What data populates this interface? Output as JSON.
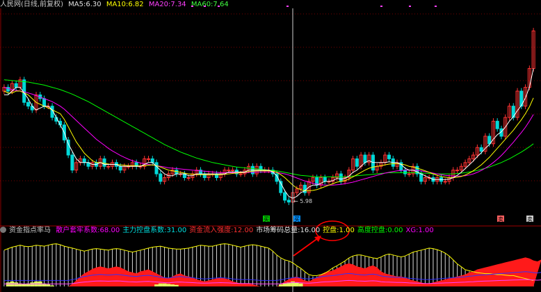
{
  "top_legend": {
    "stock": "人民网(日线,前复权)",
    "ma5_label": "MA5:",
    "ma5": "6.30",
    "ma10_label": "MA10:",
    "ma10": "6.82",
    "ma20_label": "MA20:",
    "ma20": "7.34",
    "ma60_label": "MA60:",
    "ma60": "7.64"
  },
  "indicator_legend": {
    "name": "资金指点率马",
    "items": [
      {
        "label": "散户套牢系数:",
        "value": "68.00",
        "color": "#ff00ff"
      },
      {
        "label": "主力控盘系数:",
        "value": "31.00",
        "color": "#00e0e0"
      },
      {
        "label": "资金流入强度:",
        "value": "12.00",
        "color": "#ff3030"
      },
      {
        "label": "市场筹码总量:",
        "value": "16.00",
        "color": "#e0e0e0"
      },
      {
        "label": "控盘:",
        "value": "1.00",
        "color": "#ffff00"
      },
      {
        "label": "高度控盘:",
        "value": "0.00",
        "color": "#00ff00"
      },
      {
        "label": "XG:",
        "value": "1.00",
        "color": "#ff00ff"
      }
    ]
  },
  "markers": {
    "low_label": "5.98",
    "buy_labels": [
      "买",
      "买"
    ],
    "sell_label": "卖"
  },
  "colors": {
    "up": "#ff3232",
    "down": "#00d8d8",
    "ma5": "#ffffff",
    "ma10": "#ffff00",
    "ma20": "#ff00ff",
    "ma60": "#00ff00",
    "grid": "#7a0000",
    "crosshair": "#d0d0d0",
    "annotation": "#ff0000"
  },
  "chart_data": {
    "type": "candlestick",
    "price_range": [
      5.6,
      11.2
    ],
    "grid": true,
    "closes": [
      9.1,
      9.0,
      9.2,
      9.1,
      9.3,
      8.7,
      8.6,
      8.5,
      8.9,
      8.8,
      8.6,
      8.6,
      8.3,
      8.2,
      8.1,
      7.7,
      7.3,
      6.9,
      7.1,
      7.2,
      7.1,
      7.0,
      7.1,
      7.0,
      7.2,
      7.0,
      7.0,
      7.1,
      7.0,
      6.9,
      7.0,
      7.0,
      7.1,
      7.0,
      7.0,
      7.2,
      7.2,
      7.1,
      6.8,
      6.6,
      6.7,
      6.8,
      6.9,
      6.8,
      6.8,
      6.7,
      6.7,
      6.8,
      6.9,
      6.8,
      6.7,
      6.8,
      6.8,
      6.7,
      6.8,
      6.9,
      6.9,
      6.9,
      6.8,
      6.8,
      6.9,
      7.0,
      6.8,
      7.0,
      6.9,
      6.9,
      6.9,
      6.8,
      6.6,
      6.3,
      6.1,
      6.05,
      6.3,
      6.4,
      6.5,
      6.3,
      6.6,
      6.7,
      6.5,
      6.7,
      6.6,
      6.6,
      6.7,
      6.8,
      6.6,
      6.7,
      6.9,
      7.2,
      7.0,
      7.3,
      7.1,
      7.3,
      6.9,
      7.0,
      7.1,
      7.3,
      7.2,
      7.0,
      7.1,
      6.9,
      6.8,
      6.8,
      7.0,
      6.8,
      6.6,
      6.7,
      6.7,
      6.6,
      6.7,
      6.6,
      6.6,
      6.7,
      6.9,
      6.9,
      7.0,
      7.1,
      7.2,
      7.3,
      7.5,
      7.4,
      7.8,
      7.6,
      8.2,
      8.0,
      7.8,
      8.3,
      8.6,
      8.3,
      9.0,
      8.6,
      9.1,
      9.6,
      10.6
    ],
    "ma5": [
      8.9,
      8.9,
      9.0,
      9.1,
      9.1,
      8.95,
      8.8,
      8.6,
      8.5,
      8.55,
      8.6,
      8.6,
      8.5,
      8.3,
      8.1,
      7.9,
      7.6,
      7.4,
      7.2,
      7.1,
      7.1,
      7.1,
      7.05,
      7.05,
      7.1,
      7.05,
      7.05,
      7.05,
      7.05,
      7.0,
      7.0,
      7.0,
      7.0,
      7.0,
      7.0,
      7.05,
      7.1,
      7.1,
      7.0,
      6.9,
      6.8,
      6.75,
      6.75,
      6.8,
      6.8,
      6.8,
      6.75,
      6.75,
      6.8,
      6.8,
      6.8,
      6.8,
      6.8,
      6.8,
      6.8,
      6.8,
      6.85,
      6.85,
      6.85,
      6.85,
      6.85,
      6.9,
      6.9,
      6.9,
      6.9,
      6.9,
      6.9,
      6.85,
      6.75,
      6.55,
      6.35,
      6.2,
      6.15,
      6.2,
      6.3,
      6.35,
      6.45,
      6.5,
      6.5,
      6.55,
      6.6,
      6.6,
      6.62,
      6.68,
      6.66,
      6.68,
      6.74,
      6.84,
      6.9,
      7.0,
      7.1,
      7.15,
      7.1,
      7.1,
      7.1,
      7.1,
      7.12,
      7.1,
      7.1,
      7.05,
      6.95,
      6.9,
      6.9,
      6.85,
      6.8,
      6.75,
      6.7,
      6.65,
      6.65,
      6.65,
      6.65,
      6.66,
      6.7,
      6.76,
      6.84,
      6.94,
      7.04,
      7.14,
      7.26,
      7.36,
      7.48,
      7.58,
      7.72,
      7.84,
      7.92,
      8.04,
      8.2,
      8.32,
      8.48,
      8.62,
      8.82,
      9.1,
      9.6
    ],
    "ma10": [
      9.0,
      8.95,
      8.95,
      9.0,
      9.0,
      8.95,
      8.9,
      8.8,
      8.7,
      8.65,
      8.6,
      8.55,
      8.5,
      8.45,
      8.4,
      8.25,
      8.05,
      7.85,
      7.65,
      7.5,
      7.35,
      7.25,
      7.15,
      7.1,
      7.1,
      7.08,
      7.06,
      7.05,
      7.05,
      7.04,
      7.03,
      7.02,
      7.02,
      7.02,
      7.01,
      7.02,
      7.03,
      7.04,
      7.02,
      6.98,
      6.94,
      6.9,
      6.88,
      6.86,
      6.84,
      6.82,
      6.8,
      6.79,
      6.78,
      6.78,
      6.78,
      6.78,
      6.78,
      6.78,
      6.78,
      6.79,
      6.8,
      6.81,
      6.82,
      6.83,
      6.84,
      6.86,
      6.87,
      6.88,
      6.88,
      6.88,
      6.88,
      6.87,
      6.84,
      6.78,
      6.7,
      6.6,
      6.5,
      6.42,
      6.38,
      6.35,
      6.35,
      6.36,
      6.38,
      6.42,
      6.46,
      6.5,
      6.54,
      6.58,
      6.6,
      6.62,
      6.66,
      6.72,
      6.78,
      6.84,
      6.9,
      6.95,
      6.98,
      7.0,
      7.02,
      7.04,
      7.06,
      7.07,
      7.07,
      7.06,
      7.04,
      7.0,
      6.98,
      6.95,
      6.92,
      6.88,
      6.84,
      6.8,
      6.76,
      6.73,
      6.71,
      6.7,
      6.7,
      6.71,
      6.73,
      6.77,
      6.82,
      6.88,
      6.96,
      7.04,
      7.14,
      7.24,
      7.36,
      7.48,
      7.6,
      7.72,
      7.84,
      7.96,
      8.1,
      8.24,
      8.4,
      8.58,
      8.82
    ],
    "ma20": [
      9.1,
      9.07,
      9.04,
      9.02,
      9.0,
      8.98,
      8.95,
      8.92,
      8.88,
      8.84,
      8.8,
      8.76,
      8.72,
      8.66,
      8.6,
      8.52,
      8.42,
      8.32,
      8.22,
      8.12,
      8.02,
      7.92,
      7.82,
      7.72,
      7.64,
      7.56,
      7.48,
      7.41,
      7.35,
      7.29,
      7.24,
      7.19,
      7.15,
      7.12,
      7.09,
      7.07,
      7.05,
      7.04,
      7.02,
      7.0,
      6.98,
      6.96,
      6.95,
      6.94,
      6.93,
      6.92,
      6.91,
      6.9,
      6.89,
      6.88,
      6.87,
      6.86,
      6.85,
      6.84,
      6.83,
      6.83,
      6.83,
      6.83,
      6.83,
      6.83,
      6.83,
      6.84,
      6.84,
      6.85,
      6.85,
      6.85,
      6.85,
      6.85,
      6.84,
      6.82,
      6.8,
      6.77,
      6.73,
      6.69,
      6.65,
      6.61,
      6.58,
      6.55,
      6.53,
      6.51,
      6.5,
      6.5,
      6.5,
      6.51,
      6.52,
      6.54,
      6.56,
      6.58,
      6.61,
      6.64,
      6.67,
      6.7,
      6.73,
      6.76,
      6.79,
      6.82,
      6.84,
      6.86,
      6.88,
      6.89,
      6.9,
      6.9,
      6.9,
      6.89,
      6.88,
      6.86,
      6.84,
      6.82,
      6.8,
      6.78,
      6.76,
      6.75,
      6.74,
      6.74,
      6.74,
      6.75,
      6.77,
      6.8,
      6.84,
      6.89,
      6.95,
      7.02,
      7.1,
      7.19,
      7.29,
      7.4,
      7.52,
      7.64,
      7.77,
      7.9,
      8.04,
      8.2,
      8.38
    ],
    "ma60": [
      9.3,
      9.29,
      9.28,
      9.27,
      9.26,
      9.25,
      9.24,
      9.22,
      9.2,
      9.18,
      9.16,
      9.13,
      9.1,
      9.07,
      9.04,
      9.0,
      8.96,
      8.92,
      8.87,
      8.82,
      8.77,
      8.72,
      8.66,
      8.6,
      8.54,
      8.48,
      8.42,
      8.36,
      8.3,
      8.24,
      8.18,
      8.12,
      8.06,
      8.0,
      7.94,
      7.88,
      7.82,
      7.76,
      7.7,
      7.64,
      7.58,
      7.53,
      7.48,
      7.43,
      7.38,
      7.34,
      7.3,
      7.26,
      7.22,
      7.19,
      7.16,
      7.13,
      7.1,
      7.08,
      7.06,
      7.04,
      7.02,
      7.0,
      6.98,
      6.97,
      6.96,
      6.95,
      6.94,
      6.93,
      6.92,
      6.91,
      6.9,
      6.89,
      6.88,
      6.86,
      6.84,
      6.82,
      6.8,
      6.78,
      6.76,
      6.75,
      6.74,
      6.73,
      6.72,
      6.72,
      6.72,
      6.72,
      6.72,
      6.72,
      6.72,
      6.72,
      6.73,
      6.74,
      6.75,
      6.76,
      6.77,
      6.78,
      6.79,
      6.8,
      6.81,
      6.82,
      6.83,
      6.83,
      6.83,
      6.83,
      6.83,
      6.83,
      6.83,
      6.83,
      6.82,
      6.82,
      6.81,
      6.8,
      6.8,
      6.8,
      6.8,
      6.8,
      6.8,
      6.81,
      6.82,
      6.83,
      6.85,
      6.87,
      6.89,
      6.92,
      6.95,
      6.98,
      7.02,
      7.06,
      7.1,
      7.15,
      7.2,
      7.26,
      7.32,
      7.38,
      7.45,
      7.52,
      7.6
    ],
    "indicator_white": [
      0.72,
      0.75,
      0.78,
      0.8,
      0.82,
      0.8,
      0.79,
      0.8,
      0.82,
      0.81,
      0.8,
      0.82,
      0.84,
      0.85,
      0.83,
      0.8,
      0.78,
      0.76,
      0.74,
      0.72,
      0.7,
      0.72,
      0.74,
      0.75,
      0.74,
      0.73,
      0.72,
      0.74,
      0.75,
      0.74,
      0.72,
      0.7,
      0.68,
      0.7,
      0.72,
      0.74,
      0.76,
      0.78,
      0.79,
      0.8,
      0.78,
      0.76,
      0.75,
      0.74,
      0.74,
      0.75,
      0.76,
      0.78,
      0.8,
      0.82,
      0.81,
      0.8,
      0.8,
      0.82,
      0.84,
      0.85,
      0.84,
      0.82,
      0.8,
      0.78,
      0.8,
      0.82,
      0.83,
      0.82,
      0.8,
      0.78,
      0.76,
      0.7,
      0.62,
      0.56,
      0.52,
      0.5,
      0.46,
      0.4,
      0.35,
      0.28,
      0.22,
      0.2,
      0.2,
      0.22,
      0.25,
      0.3,
      0.36,
      0.4,
      0.45,
      0.5,
      0.56,
      0.6,
      0.62,
      0.62,
      0.6,
      0.58,
      0.56,
      0.55,
      0.58,
      0.62,
      0.64,
      0.62,
      0.6,
      0.58,
      0.6,
      0.64,
      0.68,
      0.7,
      0.72,
      0.74,
      0.76,
      0.75,
      0.73,
      0.7,
      0.66,
      0.6,
      0.52,
      0.44,
      0.38,
      0.32,
      0.3,
      0.28,
      0.26,
      0.25,
      0.24,
      0.24,
      0.23,
      0.22,
      0.22,
      0.21,
      0.2,
      0.2,
      0.18,
      0.16,
      0.14,
      0.12,
      0.1
    ],
    "indicator_red": [
      0,
      0,
      0,
      0,
      0,
      0,
      0,
      0,
      0,
      0,
      0,
      0,
      0,
      0,
      0,
      0,
      0,
      0.05,
      0.12,
      0.2,
      0.26,
      0.3,
      0.35,
      0.38,
      0.4,
      0.38,
      0.36,
      0.38,
      0.4,
      0.38,
      0.34,
      0.3,
      0.28,
      0.26,
      0.3,
      0.32,
      0.34,
      0.3,
      0.26,
      0.22,
      0.18,
      0.16,
      0.2,
      0.24,
      0.26,
      0.22,
      0.2,
      0.18,
      0.14,
      0.12,
      0.1,
      0.12,
      0.14,
      0.16,
      0.18,
      0.16,
      0.14,
      0.1,
      0.08,
      0.06,
      0.06,
      0.06,
      0.04,
      0.02,
      0,
      0,
      0,
      0,
      0,
      0.04,
      0.1,
      0.14,
      0.18,
      0.2,
      0.16,
      0.12,
      0.1,
      0.14,
      0.18,
      0.24,
      0.28,
      0.3,
      0.32,
      0.36,
      0.4,
      0.44,
      0.46,
      0.44,
      0.4,
      0.38,
      0.36,
      0.4,
      0.42,
      0.38,
      0.3,
      0.26,
      0.24,
      0.22,
      0.2,
      0.2,
      0.18,
      0.14,
      0.12,
      0.1,
      0.08,
      0.06,
      0.06,
      0.08,
      0.1,
      0.12,
      0.14,
      0.16,
      0.18,
      0.2,
      0.22,
      0.24,
      0.28,
      0.3,
      0.34,
      0.36,
      0.38,
      0.4,
      0.42,
      0.44,
      0.46,
      0.48,
      0.5,
      0.52,
      0.54,
      0.56,
      0.58,
      0.56,
      0.52,
      0.5,
      0.54
    ],
    "indicator_yellow": [
      0,
      0.08,
      0.1,
      0.08,
      0.06,
      0.05,
      0.06,
      0.08,
      0.1,
      0.1,
      0.06,
      0.04,
      0.02,
      0,
      0,
      0,
      0,
      0,
      0,
      0,
      0,
      0,
      0,
      0,
      0,
      0,
      0,
      0,
      0,
      0,
      0,
      0,
      0,
      0,
      0,
      0,
      0,
      0,
      0.04,
      0.06,
      0.06,
      0.05,
      0.04,
      0.03,
      0,
      0,
      0,
      0,
      0,
      0,
      0,
      0,
      0,
      0,
      0,
      0,
      0,
      0,
      0,
      0,
      0,
      0,
      0,
      0,
      0,
      0,
      0,
      0,
      0,
      0.04,
      0.06,
      0.08,
      0.1,
      0.08,
      0.06,
      0,
      0,
      0,
      0,
      0,
      0,
      0,
      0,
      0,
      0,
      0,
      0,
      0,
      0,
      0,
      0,
      0,
      0,
      0,
      0,
      0,
      0,
      0,
      0,
      0,
      0,
      0,
      0,
      0,
      0,
      0,
      0,
      0,
      0,
      0,
      0,
      0,
      0,
      0,
      0,
      0,
      0,
      0,
      0,
      0,
      0,
      0,
      0,
      0,
      0,
      0,
      0,
      0,
      0,
      0,
      0,
      0,
      0,
      0,
      0
    ]
  }
}
